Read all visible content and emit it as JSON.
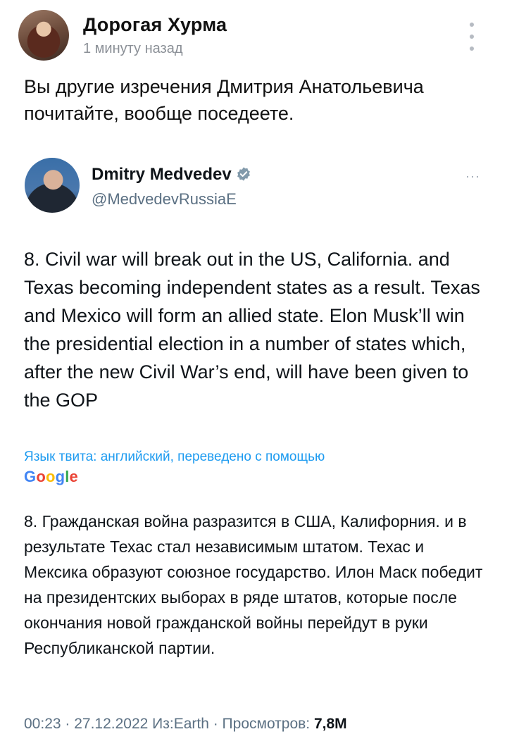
{
  "post": {
    "author": "Дорогая Хурма",
    "time": "1 минуту назад",
    "text": "Вы другие изречения Дмитрия Анатольевича почитайте, вообще поседеете."
  },
  "tweet": {
    "name": "Dmitry Medvedev",
    "handle": "@MedvedevRussiaE",
    "more": "···",
    "text": "8. Civil war will break out in the US, California. and Texas becoming independent states as a result. Texas and Mexico will form an allied state. Elon Musk’ll win the presidential election in a number of states which, after the new Civil War’s end, will have been given to the GOP",
    "translation_note": "Язык твита: английский, переведено с помощью",
    "translation_brand": "Google",
    "translated_text": "8. Гражданская война разразится в США, Калифорния. и в результате Техас стал независимым штатом. Техас и Мексика образуют союзное государство. Илон Маск победит на президентских выборах в ряде штатов, которые после окончания новой гражданской войны перейдут в руки Республиканской партии.",
    "meta_prefix": "00:23 · 27.12.2022 Из:Earth · Просмотров: ",
    "views": "7,8M"
  },
  "icons": {
    "menu": "kebab-menu-icon",
    "verified": "verified-badge-icon"
  },
  "colors": {
    "link_blue": "#1d9bf0",
    "muted": "#5b7083"
  }
}
